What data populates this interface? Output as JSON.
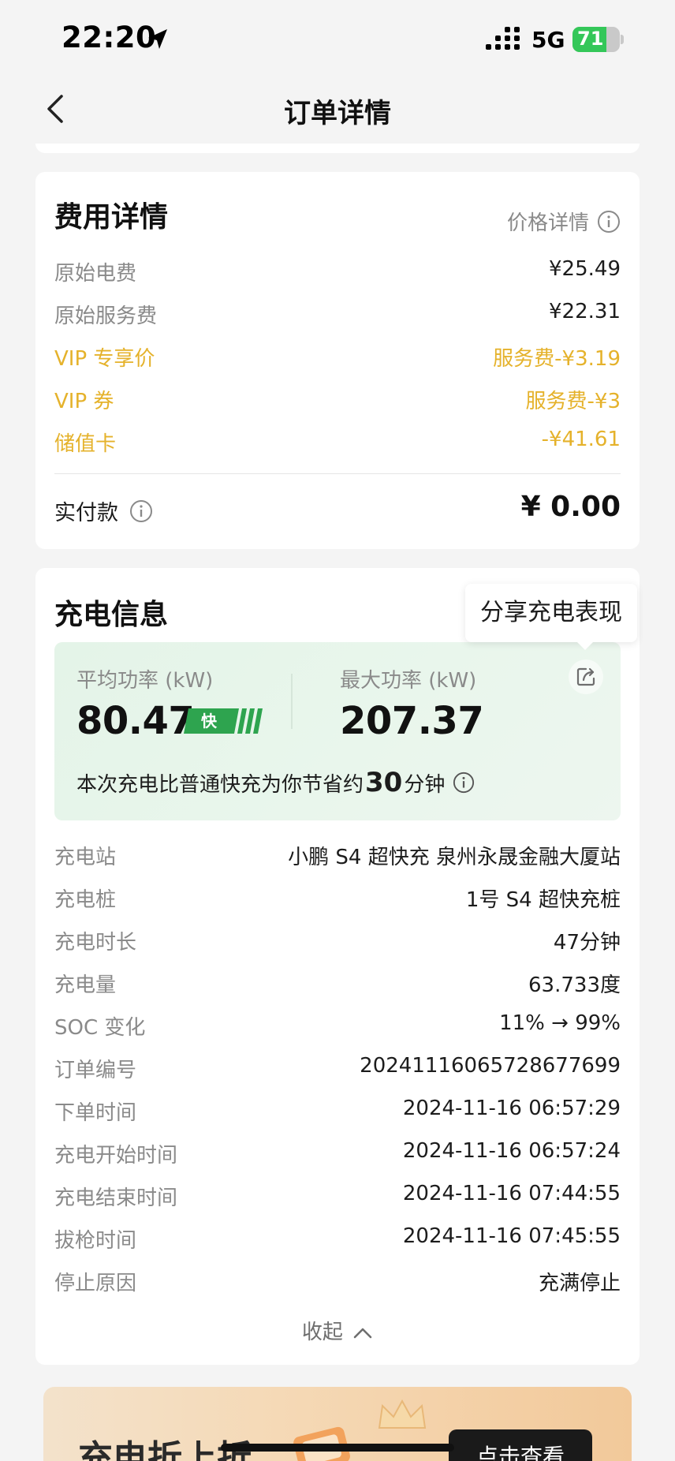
{
  "status_bar": {
    "time": "22:20",
    "network": "5G",
    "battery": "71",
    "battery_level": 0.71
  },
  "nav": {
    "title": "订单详情"
  },
  "fee": {
    "title": "费用详情",
    "price_detail_link": "价格详情",
    "rows": [
      {
        "label": "原始电费",
        "value": "¥25.49"
      },
      {
        "label": "原始服务费",
        "value": "¥22.31"
      },
      {
        "label": "VIP 专享价",
        "value": "服务费-¥3.19"
      },
      {
        "label": "VIP 券",
        "value": "服务费-¥3"
      },
      {
        "label": "储值卡",
        "value": "-¥41.61"
      }
    ],
    "paid_label": "实付款",
    "paid_value": "¥ 0.00",
    "highlight_color": "#e5b22b"
  },
  "charge": {
    "title": "充电信息",
    "tooltip": "分享充电表现",
    "avg_power_label": "平均功率 (kW)",
    "avg_power_value": "80.47",
    "fast_badge": "快",
    "max_power_label": "最大功率 (kW)",
    "max_power_value": "207.37",
    "saving_prefix": "本次充电比普通快充为你节省约",
    "saving_minutes": "30",
    "saving_suffix": "分钟",
    "rows": [
      {
        "label": "充电站",
        "value": "小鹏 S4 超快充 泉州永晟金融大厦站"
      },
      {
        "label": "充电桩",
        "value": "1号 S4 超快充桩"
      },
      {
        "label": "充电时长",
        "value": "47分钟"
      },
      {
        "label": "充电量",
        "value": "63.733度"
      },
      {
        "label": "SOC 变化",
        "value": "11% → 99%"
      },
      {
        "label": "订单编号",
        "value": "20241116065728677699"
      },
      {
        "label": "下单时间",
        "value": "2024-11-16 06:57:29"
      },
      {
        "label": "充电开始时间",
        "value": "2024-11-16 06:57:24"
      },
      {
        "label": "充电结束时间",
        "value": "2024-11-16 07:44:55"
      },
      {
        "label": "拔枪时间",
        "value": "2024-11-16 07:45:55"
      },
      {
        "label": "停止原因",
        "value": "充满停止"
      }
    ],
    "collapse_label": "收起",
    "accent_color": "#2ea44f"
  },
  "banner": {
    "text": "充电折上折",
    "button": "点击查看"
  }
}
